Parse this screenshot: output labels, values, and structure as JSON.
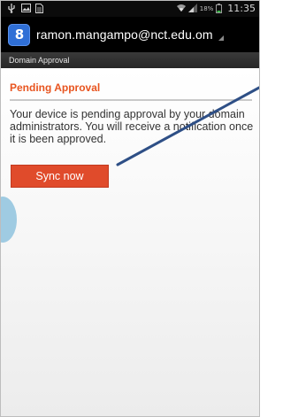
{
  "status_bar": {
    "battery": "18%",
    "time": "11:35"
  },
  "action_bar": {
    "account": "ramon.mangampo@nct.edu.om",
    "app_icon_letter": "8"
  },
  "screen_title": "Domain Approval",
  "content": {
    "section_title": "Pending Approval",
    "message": "Your device is pending approval by your domain administrators. You will receive a notification once it is been approved.",
    "sync_button": "Sync now"
  },
  "colors": {
    "accent": "#e8541f",
    "button": "#e04b2b",
    "arrow": "#2e4f86"
  }
}
